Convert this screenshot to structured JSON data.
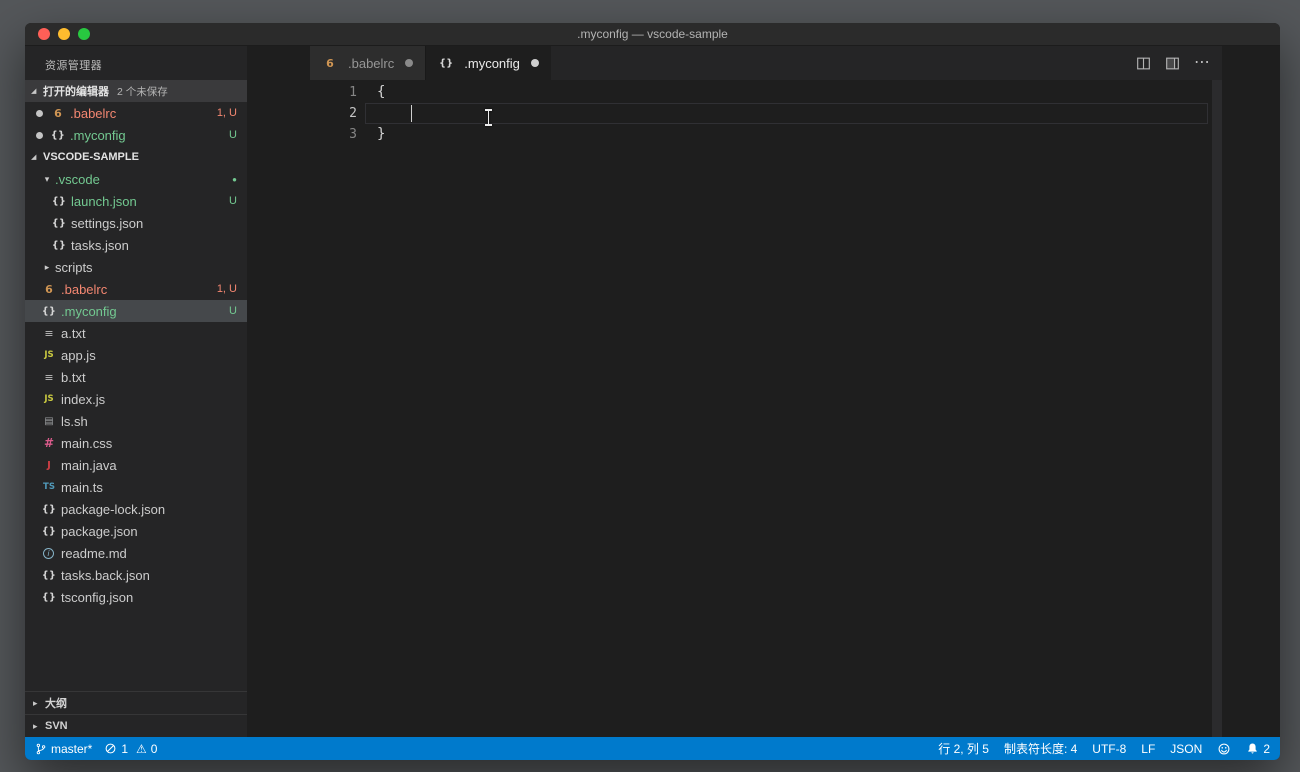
{
  "titlebar": {
    "title": ".myconfig — vscode-sample"
  },
  "sidebar": {
    "title": "资源管理器",
    "sections": {
      "open_editors": {
        "label": "打开的编辑器",
        "badge": "2 个未保存"
      },
      "project": {
        "label": "VSCODE-SAMPLE"
      }
    },
    "open_editor_items": [
      {
        "label": ".babelrc",
        "icon": "babel",
        "modified": true,
        "badge": "1, U",
        "state": "error"
      },
      {
        "label": ".myconfig",
        "icon": "json",
        "modified": true,
        "badge": "U",
        "state": "untracked"
      }
    ],
    "tree": [
      {
        "label": ".vscode",
        "kind": "folder",
        "expanded": true,
        "state": "untracked",
        "badge": "●",
        "indent": 0
      },
      {
        "label": "launch.json",
        "icon": "json",
        "state": "untracked",
        "badge": "U",
        "indent": 1
      },
      {
        "label": "settings.json",
        "icon": "json",
        "indent": 1
      },
      {
        "label": "tasks.json",
        "icon": "json",
        "indent": 1
      },
      {
        "label": "scripts",
        "kind": "folder",
        "expanded": false,
        "indent": 0
      },
      {
        "label": ".babelrc",
        "icon": "babel",
        "state": "error",
        "badge": "1, U",
        "indent": 0
      },
      {
        "label": ".myconfig",
        "icon": "json",
        "state": "untracked",
        "badge": "U",
        "selected": true,
        "indent": 0
      },
      {
        "label": "a.txt",
        "icon": "text",
        "indent": 0
      },
      {
        "label": "app.js",
        "icon": "js",
        "indent": 0
      },
      {
        "label": "b.txt",
        "icon": "text",
        "indent": 0
      },
      {
        "label": "index.js",
        "icon": "js",
        "indent": 0
      },
      {
        "label": "ls.sh",
        "icon": "shell",
        "indent": 0
      },
      {
        "label": "main.css",
        "icon": "css",
        "indent": 0
      },
      {
        "label": "main.java",
        "icon": "java",
        "indent": 0
      },
      {
        "label": "main.ts",
        "icon": "ts",
        "indent": 0
      },
      {
        "label": "package-lock.json",
        "icon": "json",
        "indent": 0
      },
      {
        "label": "package.json",
        "icon": "json",
        "indent": 0
      },
      {
        "label": "readme.md",
        "icon": "md",
        "indent": 0
      },
      {
        "label": "tasks.back.json",
        "icon": "json",
        "indent": 0
      },
      {
        "label": "tsconfig.json",
        "icon": "json",
        "indent": 0
      }
    ],
    "bottom_panels": [
      {
        "label": "大纲"
      },
      {
        "label": "SVN"
      }
    ]
  },
  "editor": {
    "tabs": [
      {
        "label": ".babelrc",
        "icon": "babel",
        "modified": true,
        "active": false
      },
      {
        "label": ".myconfig",
        "icon": "json",
        "modified": true,
        "active": true
      }
    ],
    "actions": [
      "split-editor",
      "toggle-layout",
      "more-actions"
    ],
    "lines": [
      {
        "number": "1",
        "text": "{"
      },
      {
        "number": "2",
        "text": "",
        "active": true
      },
      {
        "number": "3",
        "text": "}"
      }
    ],
    "cursor": {
      "line": 2,
      "column": 5
    }
  },
  "status_bar": {
    "branch": "master*",
    "errors": "1",
    "warnings": "0",
    "cursor_position": "行 2, 列 5",
    "tab_size": "制表符长度: 4",
    "encoding": "UTF-8",
    "eol": "LF",
    "language": "JSON",
    "notifications": "2"
  },
  "colors": {
    "accent": "#007acc",
    "untracked_green": "#73c991",
    "error_red": "#f48771",
    "editor_bg": "#1e1e1e",
    "sidebar_bg": "#252526"
  }
}
